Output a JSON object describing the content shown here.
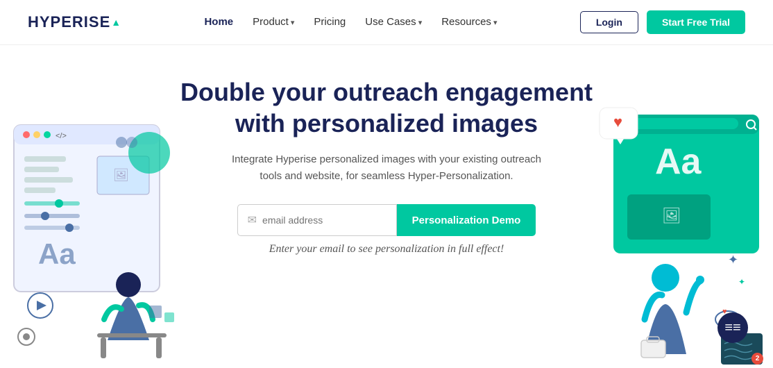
{
  "navbar": {
    "logo_text": "HYPERISE",
    "logo_accent": "▲",
    "links": [
      {
        "label": "Home",
        "active": true,
        "has_arrow": false
      },
      {
        "label": "Product",
        "active": false,
        "has_arrow": true
      },
      {
        "label": "Pricing",
        "active": false,
        "has_arrow": false
      },
      {
        "label": "Use Cases",
        "active": false,
        "has_arrow": true
      },
      {
        "label": "Resources",
        "active": false,
        "has_arrow": true
      }
    ],
    "login_label": "Login",
    "trial_label": "Start Free Trial"
  },
  "hero": {
    "title_line1": "Double your outreach engagement",
    "title_line2": "with personalized images",
    "subtitle": "Integrate Hyperise personalized images with your existing outreach tools and website, for seamless Hyper-Personalization.",
    "email_placeholder": "email address",
    "demo_button_label": "Personalization Demo",
    "note": "Enter your email to see personalization in full effect!"
  },
  "chat": {
    "badge_count": "2",
    "icon": "≡"
  }
}
